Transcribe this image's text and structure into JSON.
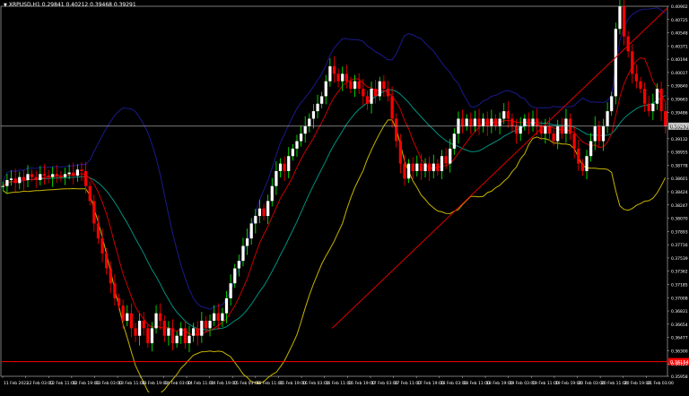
{
  "header": {
    "symbol_line": "XRPUSD,H1  0.29841 0.40212 0.39468 0.39291"
  },
  "colors": {
    "background": "#000000",
    "frame": "#c8c8c8",
    "bull_candle": "#ffffff",
    "bear_candle": "#ff0000",
    "wick": "#00ff00",
    "ma_fast": "#c80000",
    "ma_slow": "#009080",
    "bollinger_upper": "#1a1a8c",
    "bollinger_lower": "#c8b400",
    "trendline": "#e00000",
    "horizontal_line": "#ff0000",
    "bid_line": "#c0c0c0",
    "text": "#ffffff"
  },
  "chart_data": {
    "type": "line",
    "title": "XRPUSD,H1",
    "grid": false,
    "ylim": [
      0.35958,
      0.40902
    ],
    "y_tick_labels": [
      "0.40902",
      "0.40725",
      "0.40548",
      "0.40371",
      "0.40194",
      "0.40017",
      "0.39840",
      "0.39663",
      "0.39486",
      "0.39309",
      "0.39132",
      "0.38955",
      "0.38778",
      "0.38601",
      "0.38424",
      "0.38247",
      "0.38070",
      "0.37893",
      "0.37716",
      "0.37539",
      "0.37362",
      "0.37185",
      "0.37008",
      "0.36831",
      "0.36654",
      "0.36477",
      "0.36300",
      "0.36123",
      "0.35958"
    ],
    "x_tick_labels": [
      "11 Feb 2022",
      "12 Feb 03:00",
      "12 Feb 11:00",
      "12 Feb 19:00",
      "13 Feb 03:00",
      "13 Feb 11:00",
      "13 Feb 19:00",
      "14 Feb 03:00",
      "14 Feb 11:00",
      "14 Feb 19:00",
      "15 Feb 03:00",
      "15 Feb 11:00",
      "15 Feb 19:00",
      "16 Feb 03:00",
      "16 Feb 11:00",
      "16 Feb 19:00",
      "17 Feb 03:00",
      "17 Feb 11:00",
      "17 Feb 19:00",
      "18 Feb 03:00",
      "18 Feb 11:00",
      "18 Feb 19:00",
      "19 Feb 03:00",
      "19 Feb 11:00",
      "19 Feb 19:00",
      "20 Feb 03:00",
      "20 Feb 11:00",
      "20 Feb 19:00",
      "21 Feb 03:00"
    ],
    "price_label": "0.39291",
    "horizontal_level_label": "0.36154",
    "horizontal_level": 0.36154,
    "series": [
      {
        "close": [
          0.385,
          0.3858,
          0.386,
          0.3854,
          0.3862,
          0.3858,
          0.3866,
          0.3862,
          0.3858,
          0.3866,
          0.3864,
          0.3862,
          0.3866,
          0.3864,
          0.3862,
          0.3866,
          0.3868,
          0.3864,
          0.3872,
          0.387,
          0.385,
          0.383,
          0.38,
          0.378,
          0.376,
          0.374,
          0.372,
          0.37,
          0.369,
          0.367,
          0.368,
          0.366,
          0.365,
          0.367,
          0.366,
          0.364,
          0.366,
          0.368,
          0.367,
          0.365,
          0.366,
          0.364,
          0.365,
          0.366,
          0.364,
          0.365,
          0.366,
          0.365,
          0.367,
          0.366,
          0.367,
          0.368,
          0.367,
          0.368,
          0.37,
          0.372,
          0.374,
          0.375,
          0.377,
          0.378,
          0.38,
          0.381,
          0.382,
          0.381,
          0.383,
          0.385,
          0.387,
          0.388,
          0.387,
          0.389,
          0.39,
          0.391,
          0.392,
          0.393,
          0.394,
          0.395,
          0.396,
          0.397,
          0.399,
          0.401,
          0.4,
          0.399,
          0.4,
          0.399,
          0.398,
          0.399,
          0.398,
          0.397,
          0.396,
          0.398,
          0.397,
          0.399,
          0.398,
          0.397,
          0.394,
          0.391,
          0.388,
          0.386,
          0.388,
          0.387,
          0.388,
          0.387,
          0.388,
          0.387,
          0.388,
          0.387,
          0.389,
          0.388,
          0.39,
          0.392,
          0.394,
          0.393,
          0.394,
          0.393,
          0.394,
          0.393,
          0.394,
          0.393,
          0.394,
          0.393,
          0.394,
          0.395,
          0.394,
          0.393,
          0.392,
          0.393,
          0.394,
          0.393,
          0.394,
          0.393,
          0.392,
          0.393,
          0.392,
          0.391,
          0.393,
          0.392,
          0.394,
          0.392,
          0.39,
          0.388,
          0.387,
          0.389,
          0.391,
          0.393,
          0.391,
          0.393,
          0.395,
          0.397,
          0.406,
          0.409,
          0.405,
          0.403,
          0.4,
          0.399,
          0.398,
          0.396,
          0.395,
          0.396,
          0.398,
          0.395,
          0.393
        ]
      }
    ]
  }
}
